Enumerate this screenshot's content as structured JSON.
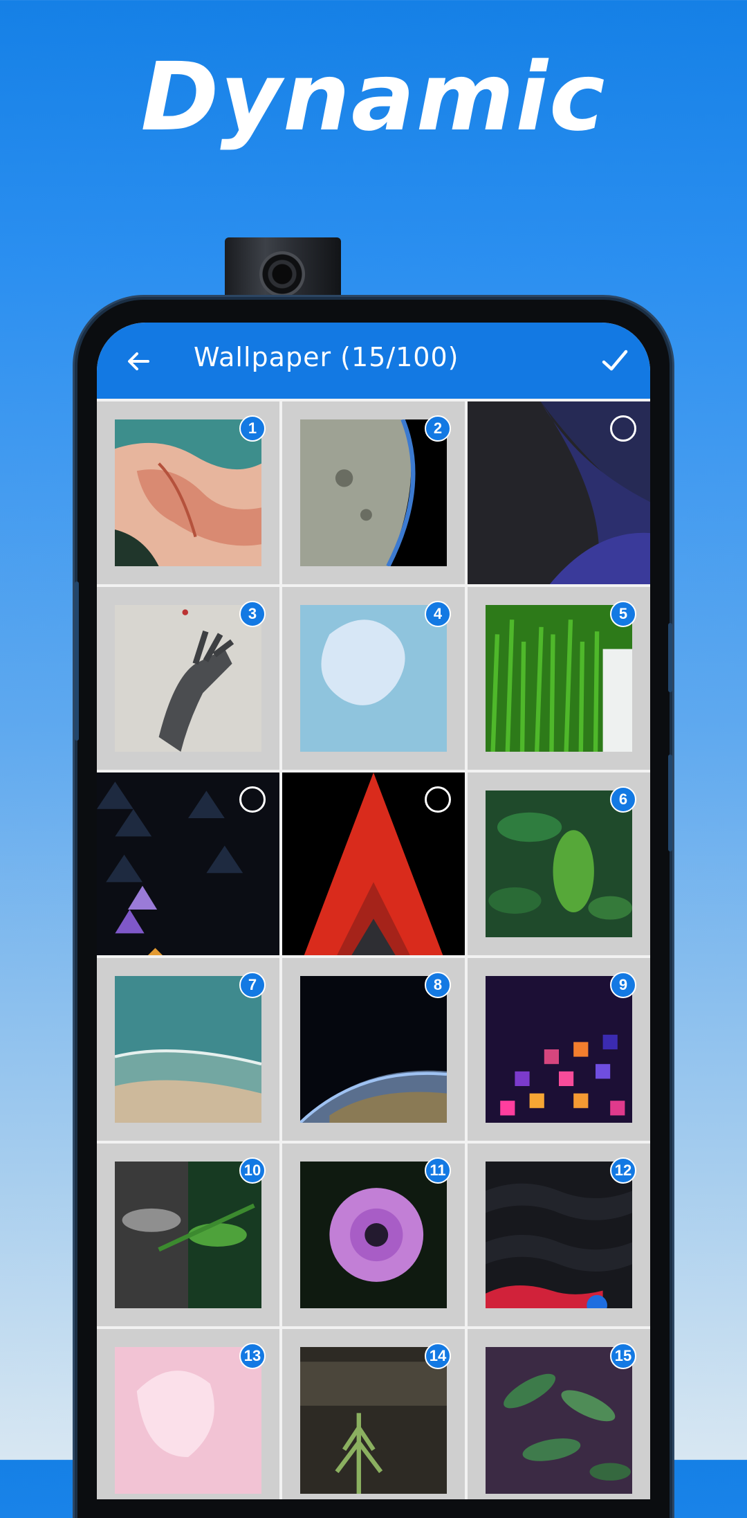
{
  "headline": "Dynamic",
  "appbar": {
    "title": "Wallpaper (15/100)"
  },
  "colors": {
    "accent": "#1379e3",
    "background_top": "#1580e6",
    "background_bottom": "#d8e7f2"
  },
  "grid": {
    "items": [
      {
        "badge": "1",
        "selected": true,
        "art": "coral-shore"
      },
      {
        "badge": "2",
        "selected": true,
        "art": "planet-limb"
      },
      {
        "badge": "",
        "selected": false,
        "art": "purple-curves"
      },
      {
        "badge": "3",
        "selected": true,
        "art": "robot-hand"
      },
      {
        "badge": "4",
        "selected": true,
        "art": "water-drop"
      },
      {
        "badge": "5",
        "selected": true,
        "art": "grass-blades"
      },
      {
        "badge": "",
        "selected": false,
        "art": "triangle-pattern"
      },
      {
        "badge": "",
        "selected": false,
        "art": "red-arrow"
      },
      {
        "badge": "6",
        "selected": true,
        "art": "green-leaves"
      },
      {
        "badge": "7",
        "selected": true,
        "art": "beach-waves"
      },
      {
        "badge": "8",
        "selected": true,
        "art": "earth-from-space"
      },
      {
        "badge": "9",
        "selected": true,
        "art": "pixel-mosaic"
      },
      {
        "badge": "10",
        "selected": true,
        "art": "fern-split"
      },
      {
        "badge": "11",
        "selected": true,
        "art": "purple-daisy"
      },
      {
        "badge": "12",
        "selected": true,
        "art": "dark-waves"
      },
      {
        "badge": "13",
        "selected": true,
        "art": "pink-petal"
      },
      {
        "badge": "14",
        "selected": true,
        "art": "pine-sprouts"
      },
      {
        "badge": "15",
        "selected": true,
        "art": "leafy-plant"
      }
    ]
  }
}
